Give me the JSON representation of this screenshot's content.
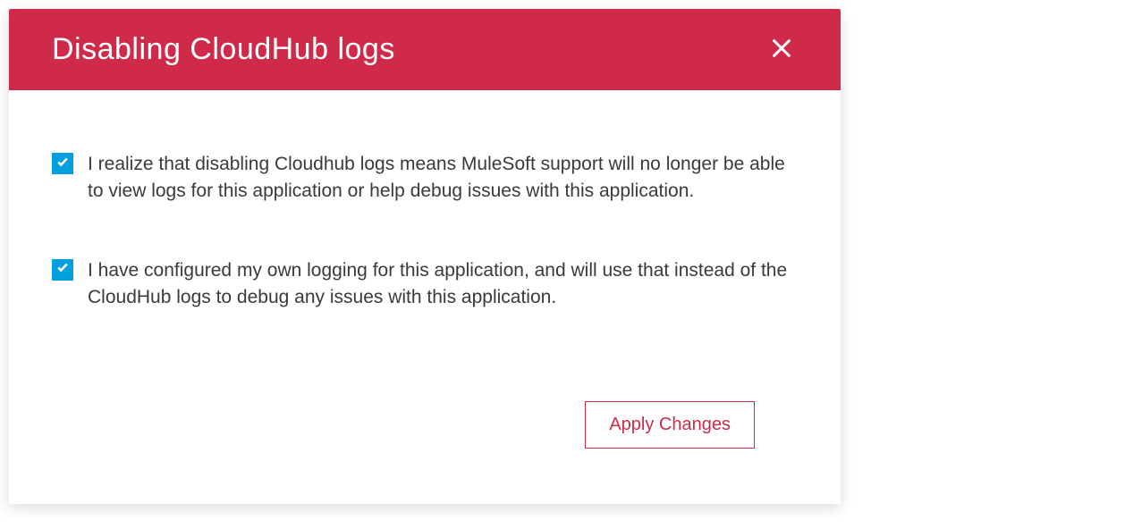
{
  "dialog": {
    "title": "Disabling CloudHub logs",
    "checkboxes": [
      {
        "label": "I realize that disabling Cloudhub logs means MuleSoft support will no longer be able to view logs for this application or help debug issues with this application.",
        "checked": true
      },
      {
        "label": "I have configured my own logging for this application, and will use that instead of the CloudHub logs to debug any issues with this application.",
        "checked": true
      }
    ],
    "apply_label": "Apply Changes"
  },
  "colors": {
    "header_bg": "#cf2a49",
    "checkbox_bg": "#00a1de",
    "button_border": "#cf2a49"
  }
}
